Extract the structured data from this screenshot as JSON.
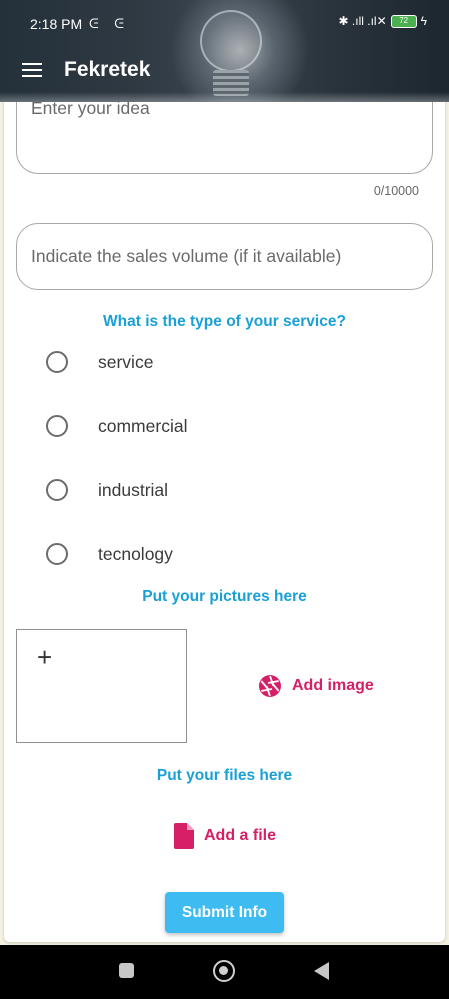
{
  "status_bar": {
    "time": "2:18 PM",
    "extra_icons": "ᕮ ᕮ",
    "signal": "✱ .ıll .ıl✕",
    "battery": "72",
    "charging": "ϟ"
  },
  "app_bar": {
    "title": "Fekretek"
  },
  "form": {
    "idea_placeholder": "Enter your idea",
    "idea_counter": "0/10000",
    "sales_placeholder": "Indicate the sales volume (if it available)",
    "service_type_title": "What is the type of your service?",
    "service_options": [
      "service",
      "commercial",
      "industrial",
      "tecnology"
    ],
    "pictures_title": "Put your pictures here",
    "add_picture_plus": "+",
    "add_image_label": "Add image",
    "files_title": "Put your files here",
    "add_file_label": "Add a file",
    "submit_label": "Submit Info"
  },
  "colors": {
    "accent_blue": "#1ba0d6",
    "accent_pink": "#d51f66",
    "submit_bg": "#3ebcf1"
  },
  "icons": {
    "menu": "hamburger-icon",
    "add_image": "camera-shutter-icon",
    "add_file": "file-icon"
  }
}
